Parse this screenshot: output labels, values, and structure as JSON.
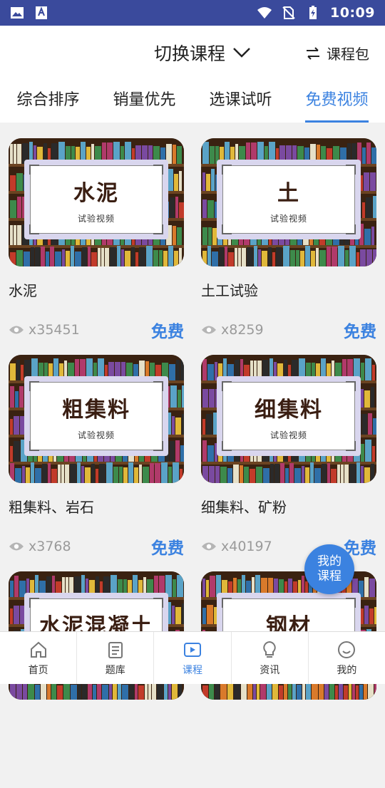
{
  "status_bar": {
    "time": "10:09"
  },
  "header": {
    "switch_course": "切换课程",
    "bundle": "课程包"
  },
  "tabs": [
    {
      "label": "综合排序"
    },
    {
      "label": "销量优先"
    },
    {
      "label": "选课试听"
    },
    {
      "label": "免费视频"
    }
  ],
  "active_tab": 3,
  "plaque_subtitle": "试验视频",
  "courses": [
    {
      "plaque": "水泥",
      "title": "水泥",
      "views": "x35451",
      "price": "免费"
    },
    {
      "plaque": "土",
      "title": "土工试验",
      "views": "x8259",
      "price": "免费"
    },
    {
      "plaque": "粗集料",
      "title": "粗集料、岩石",
      "views": "x3768",
      "price": "免费"
    },
    {
      "plaque": "细集料",
      "title": "细集料、矿粉",
      "views": "x40197",
      "price": "免费"
    },
    {
      "plaque": "水泥混凝土",
      "title": "",
      "views": "",
      "price": ""
    },
    {
      "plaque": "钢材",
      "title": "",
      "views": "",
      "price": ""
    }
  ],
  "fab": {
    "line1": "我的",
    "line2": "课程"
  },
  "bottom_nav": [
    {
      "label": "首页",
      "icon": "home-icon"
    },
    {
      "label": "题库",
      "icon": "question-bank-icon"
    },
    {
      "label": "课程",
      "icon": "video-course-icon"
    },
    {
      "label": "资讯",
      "icon": "bulb-icon"
    },
    {
      "label": "我的",
      "icon": "smile-icon"
    }
  ],
  "colors": {
    "accent": "#3b82e0",
    "status_bar": "#3a4a9c"
  }
}
